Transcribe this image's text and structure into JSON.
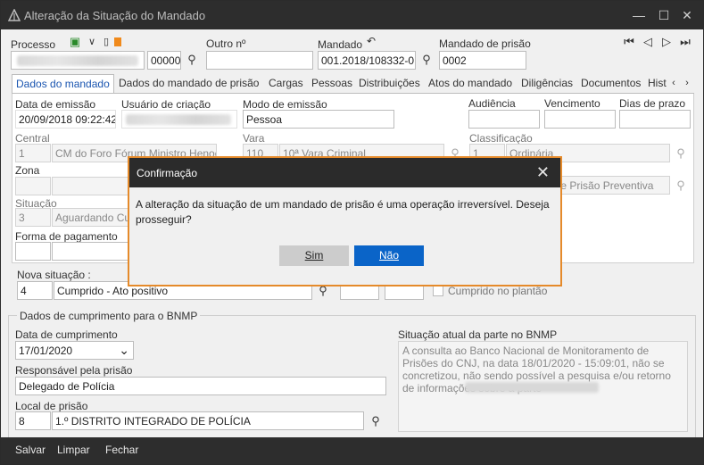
{
  "window": {
    "title": "Alteração da Situação do Mandado",
    "controls": [
      "minimize-icon",
      "maximize-icon",
      "close-icon"
    ]
  },
  "header": {
    "processo_label": "Processo",
    "processo_suffix": "00000",
    "outro_label": "Outro nº",
    "outro_value": "",
    "mandado_label": "Mandado",
    "mandado_value": "001.2018/108332-0",
    "mandado_prisao_label": "Mandado de prisão",
    "mandado_prisao_value": "0002"
  },
  "tabs": [
    {
      "label": "Dados do mandado",
      "active": true
    },
    {
      "label": "Dados do mandado de prisão"
    },
    {
      "label": "Cargas"
    },
    {
      "label": "Pessoas"
    },
    {
      "label": "Distribuições"
    },
    {
      "label": "Atos do mandado"
    },
    {
      "label": "Diligências"
    },
    {
      "label": "Documentos"
    },
    {
      "label": "Hist"
    }
  ],
  "panel": {
    "data_emissao_label": "Data de emissão",
    "data_emissao_value": "20/09/2018 09:22:42",
    "usuario_label": "Usuário de criação",
    "modo_label": "Modo de emissão",
    "modo_value": "Pessoa",
    "audiencia_label": "Audiência",
    "vencimento_label": "Vencimento",
    "dias_label": "Dias de prazo",
    "central_label": "Central",
    "central_code": "1",
    "central_value": "CM do Foro Fórum Ministro Henoch",
    "vara_label": "Vara",
    "vara_code": "110",
    "vara_value": "10ª Vara Criminal",
    "classificacao_label": "Classificação",
    "classificacao_code": "1",
    "classificacao_value": "Ordinária",
    "zona_label": "Zona",
    "tipo_value": "do de Prisão Preventiva",
    "situacao_label": "Situação",
    "situacao_code": "3",
    "situacao_value": "Aguardando Cu",
    "pagamento_label": "Forma de pagamento"
  },
  "nova": {
    "label": "Nova situação :",
    "code": "4",
    "value": "Cumprido - Ato positivo",
    "plantao_label": "Cumprido no plantão"
  },
  "bnmp": {
    "group_label": "Dados de cumprimento para o BNMP",
    "data_label": "Data de cumprimento",
    "data_value": "17/01/2020",
    "responsavel_label": "Responsável pela prisão",
    "responsavel_value": "Delegado de Polícia",
    "local_label": "Local de prisão",
    "local_code": "8",
    "local_value": "1.º DISTRITO INTEGRADO DE POLÍCIA",
    "situacao_label": "Situação atual da parte no BNMP",
    "situacao_text": "A consulta ao Banco Nacional de Monitoramento de Prisões do CNJ, na data 18/01/2020 - 15:09:01, não se concretizou, não sendo possível a pesquisa e/ou retorno de informações sobre a parte"
  },
  "bottom": {
    "salvar": "Salvar",
    "limpar": "Limpar",
    "fechar": "Fechar"
  },
  "dialog": {
    "title": "Confirmação",
    "message": "A alteração da situação de um mandado de prisão é uma operação irreversível. Deseja prosseguir?",
    "sim": "Sim",
    "nao": "Não"
  },
  "colors": {
    "accent": "#0a64c8",
    "dialog_border": "#e58a2a",
    "titlebar": "#2d2d2d"
  }
}
